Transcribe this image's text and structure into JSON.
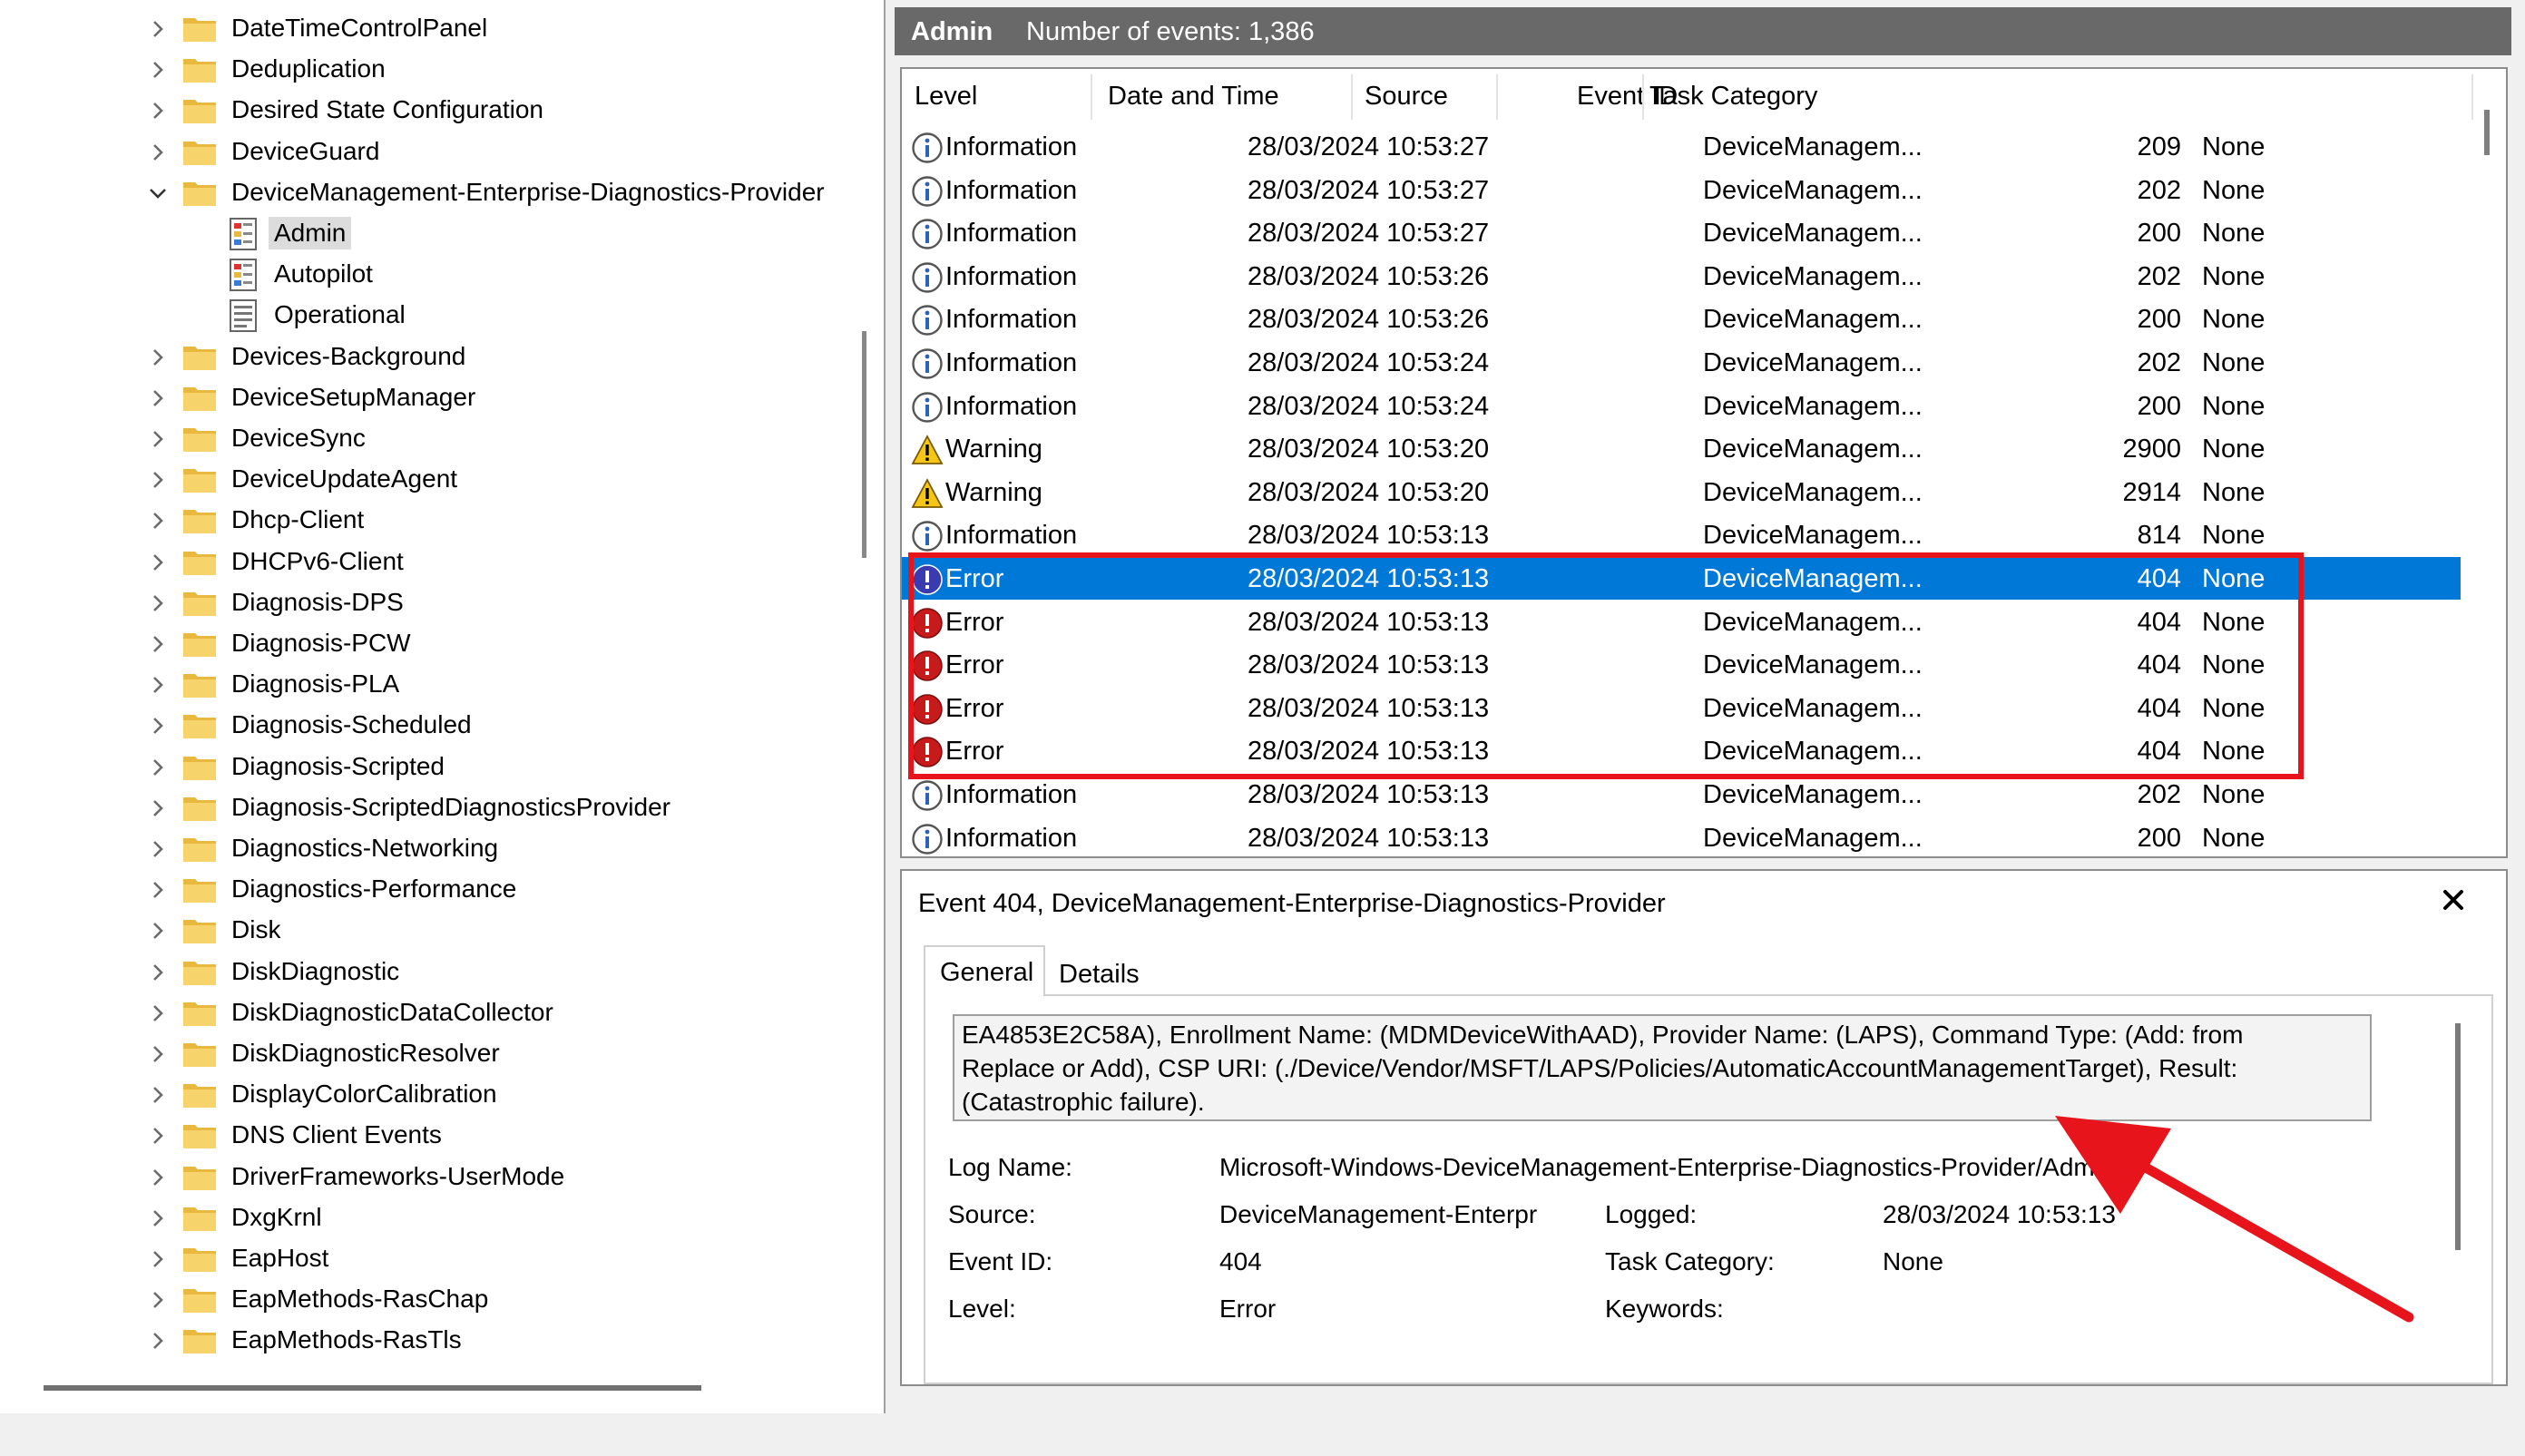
{
  "tree": {
    "items": [
      {
        "label": "DateTimeControlPanel",
        "expander": "right",
        "icon": "folder"
      },
      {
        "label": "Deduplication",
        "expander": "right",
        "icon": "folder"
      },
      {
        "label": "Desired State Configuration",
        "expander": "right",
        "icon": "folder"
      },
      {
        "label": "DeviceGuard",
        "expander": "right",
        "icon": "folder"
      },
      {
        "label": "DeviceManagement-Enterprise-Diagnostics-Provider",
        "expander": "down",
        "icon": "folder"
      },
      {
        "label": "Admin",
        "icon": "admin-log",
        "selected": true,
        "child": true
      },
      {
        "label": "Autopilot",
        "icon": "admin-log",
        "child": true
      },
      {
        "label": "Operational",
        "icon": "operational-log",
        "child": true
      },
      {
        "label": "Devices-Background",
        "expander": "right",
        "icon": "folder"
      },
      {
        "label": "DeviceSetupManager",
        "expander": "right",
        "icon": "folder"
      },
      {
        "label": "DeviceSync",
        "expander": "right",
        "icon": "folder"
      },
      {
        "label": "DeviceUpdateAgent",
        "expander": "right",
        "icon": "folder"
      },
      {
        "label": "Dhcp-Client",
        "expander": "right",
        "icon": "folder"
      },
      {
        "label": "DHCPv6-Client",
        "expander": "right",
        "icon": "folder"
      },
      {
        "label": "Diagnosis-DPS",
        "expander": "right",
        "icon": "folder"
      },
      {
        "label": "Diagnosis-PCW",
        "expander": "right",
        "icon": "folder"
      },
      {
        "label": "Diagnosis-PLA",
        "expander": "right",
        "icon": "folder"
      },
      {
        "label": "Diagnosis-Scheduled",
        "expander": "right",
        "icon": "folder"
      },
      {
        "label": "Diagnosis-Scripted",
        "expander": "right",
        "icon": "folder"
      },
      {
        "label": "Diagnosis-ScriptedDiagnosticsProvider",
        "expander": "right",
        "icon": "folder"
      },
      {
        "label": "Diagnostics-Networking",
        "expander": "right",
        "icon": "folder"
      },
      {
        "label": "Diagnostics-Performance",
        "expander": "right",
        "icon": "folder"
      },
      {
        "label": "Disk",
        "expander": "right",
        "icon": "folder"
      },
      {
        "label": "DiskDiagnostic",
        "expander": "right",
        "icon": "folder"
      },
      {
        "label": "DiskDiagnosticDataCollector",
        "expander": "right",
        "icon": "folder"
      },
      {
        "label": "DiskDiagnosticResolver",
        "expander": "right",
        "icon": "folder"
      },
      {
        "label": "DisplayColorCalibration",
        "expander": "right",
        "icon": "folder"
      },
      {
        "label": "DNS Client Events",
        "expander": "right",
        "icon": "folder"
      },
      {
        "label": "DriverFrameworks-UserMode",
        "expander": "right",
        "icon": "folder"
      },
      {
        "label": "DxgKrnl",
        "expander": "right",
        "icon": "folder"
      },
      {
        "label": "EapHost",
        "expander": "right",
        "icon": "folder"
      },
      {
        "label": "EapMethods-RasChap",
        "expander": "right",
        "icon": "folder"
      },
      {
        "label": "EapMethods-RasTls",
        "expander": "right",
        "icon": "folder"
      }
    ]
  },
  "events": {
    "title": "Admin",
    "count_text": "Number of events: 1,386",
    "columns": [
      "Level",
      "Date and Time",
      "Source",
      "Event ID",
      "Task Category"
    ],
    "rows": [
      {
        "level": "Information",
        "icon": "info-icon",
        "date": "28/03/2024 10:53:27",
        "source": "DeviceManagem...",
        "id": "209",
        "task": "None"
      },
      {
        "level": "Information",
        "icon": "info-icon",
        "date": "28/03/2024 10:53:27",
        "source": "DeviceManagem...",
        "id": "202",
        "task": "None"
      },
      {
        "level": "Information",
        "icon": "info-icon",
        "date": "28/03/2024 10:53:27",
        "source": "DeviceManagem...",
        "id": "200",
        "task": "None"
      },
      {
        "level": "Information",
        "icon": "info-icon",
        "date": "28/03/2024 10:53:26",
        "source": "DeviceManagem...",
        "id": "202",
        "task": "None"
      },
      {
        "level": "Information",
        "icon": "info-icon",
        "date": "28/03/2024 10:53:26",
        "source": "DeviceManagem...",
        "id": "200",
        "task": "None"
      },
      {
        "level": "Information",
        "icon": "info-icon",
        "date": "28/03/2024 10:53:24",
        "source": "DeviceManagem...",
        "id": "202",
        "task": "None"
      },
      {
        "level": "Information",
        "icon": "info-icon",
        "date": "28/03/2024 10:53:24",
        "source": "DeviceManagem...",
        "id": "200",
        "task": "None"
      },
      {
        "level": "Warning",
        "icon": "warning-icon",
        "date": "28/03/2024 10:53:20",
        "source": "DeviceManagem...",
        "id": "2900",
        "task": "None"
      },
      {
        "level": "Warning",
        "icon": "warning-icon",
        "date": "28/03/2024 10:53:20",
        "source": "DeviceManagem...",
        "id": "2914",
        "task": "None"
      },
      {
        "level": "Information",
        "icon": "info-icon",
        "date": "28/03/2024 10:53:13",
        "source": "DeviceManagem...",
        "id": "814",
        "task": "None"
      },
      {
        "level": "Error",
        "icon": "error-icon",
        "date": "28/03/2024 10:53:13",
        "source": "DeviceManagem...",
        "id": "404",
        "task": "None",
        "selected": true
      },
      {
        "level": "Error",
        "icon": "error-icon",
        "date": "28/03/2024 10:53:13",
        "source": "DeviceManagem...",
        "id": "404",
        "task": "None"
      },
      {
        "level": "Error",
        "icon": "error-icon",
        "date": "28/03/2024 10:53:13",
        "source": "DeviceManagem...",
        "id": "404",
        "task": "None"
      },
      {
        "level": "Error",
        "icon": "error-icon",
        "date": "28/03/2024 10:53:13",
        "source": "DeviceManagem...",
        "id": "404",
        "task": "None"
      },
      {
        "level": "Error",
        "icon": "error-icon",
        "date": "28/03/2024 10:53:13",
        "source": "DeviceManagem...",
        "id": "404",
        "task": "None"
      },
      {
        "level": "Information",
        "icon": "info-icon",
        "date": "28/03/2024 10:53:13",
        "source": "DeviceManagem...",
        "id": "202",
        "task": "None"
      },
      {
        "level": "Information",
        "icon": "info-icon",
        "date": "28/03/2024 10:53:13",
        "source": "DeviceManagem...",
        "id": "200",
        "task": "None"
      }
    ]
  },
  "detail": {
    "title": "Event 404, DeviceManagement-Enterprise-Diagnostics-Provider",
    "close_icon": "close-icon",
    "tabs": {
      "general": "General",
      "details": "Details"
    },
    "description_lines": [
      "EA4853E2C58A), Enrollment Name: (MDMDeviceWithAAD), Provider Name: (LAPS), Command Type: (Add: from",
      "Replace or Add), CSP URI: (./Device/Vendor/MSFT/LAPS/Policies/AutomaticAccountManagementTarget), Result:",
      "(Catastrophic failure)."
    ],
    "fields": {
      "log_name_label": "Log Name:",
      "log_name": "Microsoft-Windows-DeviceManagement-Enterprise-Diagnostics-Provider/Admin",
      "source_label": "Source:",
      "source": "DeviceManagement-Enterpr",
      "logged_label": "Logged:",
      "logged": "28/03/2024 10:53:13",
      "event_id_label": "Event ID:",
      "event_id": "404",
      "task_category_label": "Task Category:",
      "task_category": "None",
      "level_label": "Level:",
      "level": "Error",
      "keywords_label": "Keywords:"
    }
  },
  "colors": {
    "selection": "#0078d7",
    "header_bar": "#696969",
    "annotation_red": "#e8141b",
    "folder": "#f0c44c"
  }
}
